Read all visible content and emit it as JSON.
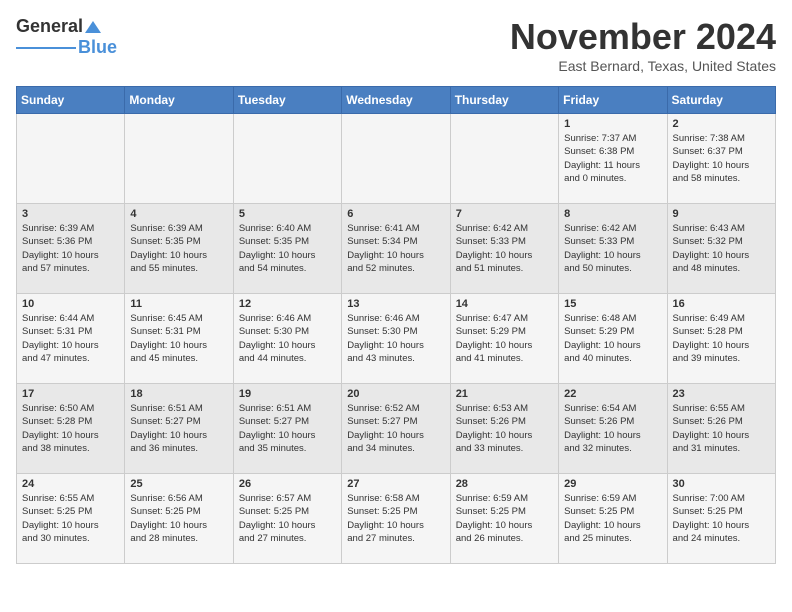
{
  "header": {
    "logo_general": "General",
    "logo_blue": "Blue",
    "month_title": "November 2024",
    "location": "East Bernard, Texas, United States"
  },
  "weekdays": [
    "Sunday",
    "Monday",
    "Tuesday",
    "Wednesday",
    "Thursday",
    "Friday",
    "Saturday"
  ],
  "weeks": [
    [
      {
        "day": "",
        "info": ""
      },
      {
        "day": "",
        "info": ""
      },
      {
        "day": "",
        "info": ""
      },
      {
        "day": "",
        "info": ""
      },
      {
        "day": "",
        "info": ""
      },
      {
        "day": "1",
        "info": "Sunrise: 7:37 AM\nSunset: 6:38 PM\nDaylight: 11 hours\nand 0 minutes."
      },
      {
        "day": "2",
        "info": "Sunrise: 7:38 AM\nSunset: 6:37 PM\nDaylight: 10 hours\nand 58 minutes."
      }
    ],
    [
      {
        "day": "3",
        "info": "Sunrise: 6:39 AM\nSunset: 5:36 PM\nDaylight: 10 hours\nand 57 minutes."
      },
      {
        "day": "4",
        "info": "Sunrise: 6:39 AM\nSunset: 5:35 PM\nDaylight: 10 hours\nand 55 minutes."
      },
      {
        "day": "5",
        "info": "Sunrise: 6:40 AM\nSunset: 5:35 PM\nDaylight: 10 hours\nand 54 minutes."
      },
      {
        "day": "6",
        "info": "Sunrise: 6:41 AM\nSunset: 5:34 PM\nDaylight: 10 hours\nand 52 minutes."
      },
      {
        "day": "7",
        "info": "Sunrise: 6:42 AM\nSunset: 5:33 PM\nDaylight: 10 hours\nand 51 minutes."
      },
      {
        "day": "8",
        "info": "Sunrise: 6:42 AM\nSunset: 5:33 PM\nDaylight: 10 hours\nand 50 minutes."
      },
      {
        "day": "9",
        "info": "Sunrise: 6:43 AM\nSunset: 5:32 PM\nDaylight: 10 hours\nand 48 minutes."
      }
    ],
    [
      {
        "day": "10",
        "info": "Sunrise: 6:44 AM\nSunset: 5:31 PM\nDaylight: 10 hours\nand 47 minutes."
      },
      {
        "day": "11",
        "info": "Sunrise: 6:45 AM\nSunset: 5:31 PM\nDaylight: 10 hours\nand 45 minutes."
      },
      {
        "day": "12",
        "info": "Sunrise: 6:46 AM\nSunset: 5:30 PM\nDaylight: 10 hours\nand 44 minutes."
      },
      {
        "day": "13",
        "info": "Sunrise: 6:46 AM\nSunset: 5:30 PM\nDaylight: 10 hours\nand 43 minutes."
      },
      {
        "day": "14",
        "info": "Sunrise: 6:47 AM\nSunset: 5:29 PM\nDaylight: 10 hours\nand 41 minutes."
      },
      {
        "day": "15",
        "info": "Sunrise: 6:48 AM\nSunset: 5:29 PM\nDaylight: 10 hours\nand 40 minutes."
      },
      {
        "day": "16",
        "info": "Sunrise: 6:49 AM\nSunset: 5:28 PM\nDaylight: 10 hours\nand 39 minutes."
      }
    ],
    [
      {
        "day": "17",
        "info": "Sunrise: 6:50 AM\nSunset: 5:28 PM\nDaylight: 10 hours\nand 38 minutes."
      },
      {
        "day": "18",
        "info": "Sunrise: 6:51 AM\nSunset: 5:27 PM\nDaylight: 10 hours\nand 36 minutes."
      },
      {
        "day": "19",
        "info": "Sunrise: 6:51 AM\nSunset: 5:27 PM\nDaylight: 10 hours\nand 35 minutes."
      },
      {
        "day": "20",
        "info": "Sunrise: 6:52 AM\nSunset: 5:27 PM\nDaylight: 10 hours\nand 34 minutes."
      },
      {
        "day": "21",
        "info": "Sunrise: 6:53 AM\nSunset: 5:26 PM\nDaylight: 10 hours\nand 33 minutes."
      },
      {
        "day": "22",
        "info": "Sunrise: 6:54 AM\nSunset: 5:26 PM\nDaylight: 10 hours\nand 32 minutes."
      },
      {
        "day": "23",
        "info": "Sunrise: 6:55 AM\nSunset: 5:26 PM\nDaylight: 10 hours\nand 31 minutes."
      }
    ],
    [
      {
        "day": "24",
        "info": "Sunrise: 6:55 AM\nSunset: 5:25 PM\nDaylight: 10 hours\nand 30 minutes."
      },
      {
        "day": "25",
        "info": "Sunrise: 6:56 AM\nSunset: 5:25 PM\nDaylight: 10 hours\nand 28 minutes."
      },
      {
        "day": "26",
        "info": "Sunrise: 6:57 AM\nSunset: 5:25 PM\nDaylight: 10 hours\nand 27 minutes."
      },
      {
        "day": "27",
        "info": "Sunrise: 6:58 AM\nSunset: 5:25 PM\nDaylight: 10 hours\nand 27 minutes."
      },
      {
        "day": "28",
        "info": "Sunrise: 6:59 AM\nSunset: 5:25 PM\nDaylight: 10 hours\nand 26 minutes."
      },
      {
        "day": "29",
        "info": "Sunrise: 6:59 AM\nSunset: 5:25 PM\nDaylight: 10 hours\nand 25 minutes."
      },
      {
        "day": "30",
        "info": "Sunrise: 7:00 AM\nSunset: 5:25 PM\nDaylight: 10 hours\nand 24 minutes."
      }
    ]
  ]
}
